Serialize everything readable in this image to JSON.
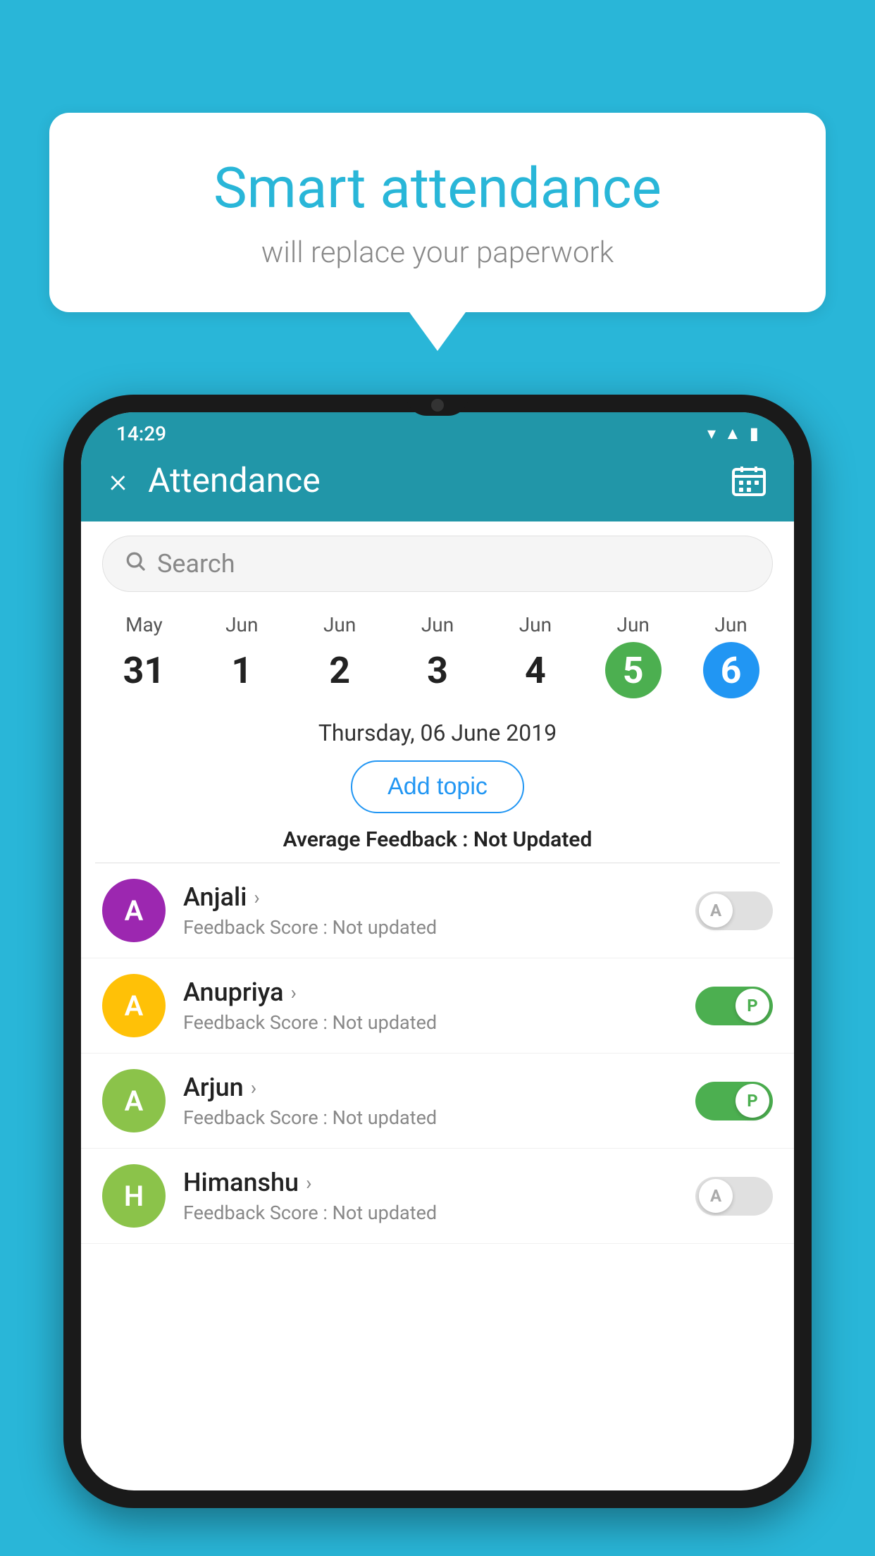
{
  "background_color": "#29B6D8",
  "speech_bubble": {
    "title": "Smart attendance",
    "subtitle": "will replace your paperwork"
  },
  "phone": {
    "status_bar": {
      "time": "14:29",
      "icons": [
        "wifi",
        "signal",
        "battery"
      ]
    },
    "header": {
      "title": "Attendance",
      "close_label": "×",
      "calendar_icon": "📅"
    },
    "search": {
      "placeholder": "Search"
    },
    "dates": [
      {
        "month": "May",
        "day": "31",
        "state": "normal"
      },
      {
        "month": "Jun",
        "day": "1",
        "state": "normal"
      },
      {
        "month": "Jun",
        "day": "2",
        "state": "normal"
      },
      {
        "month": "Jun",
        "day": "3",
        "state": "normal"
      },
      {
        "month": "Jun",
        "day": "4",
        "state": "normal"
      },
      {
        "month": "Jun",
        "day": "5",
        "state": "today"
      },
      {
        "month": "Jun",
        "day": "6",
        "state": "selected"
      }
    ],
    "selected_date": "Thursday, 06 June 2019",
    "add_topic_label": "Add topic",
    "avg_feedback": {
      "label": "Average Feedback : ",
      "value": "Not Updated"
    },
    "students": [
      {
        "name": "Anjali",
        "avatar_letter": "A",
        "avatar_color": "#9C27B0",
        "feedback": "Feedback Score : Not updated",
        "toggle_state": "off",
        "toggle_letter": "A"
      },
      {
        "name": "Anupriya",
        "avatar_letter": "A",
        "avatar_color": "#FFC107",
        "feedback": "Feedback Score : Not updated",
        "toggle_state": "on",
        "toggle_letter": "P"
      },
      {
        "name": "Arjun",
        "avatar_letter": "A",
        "avatar_color": "#8BC34A",
        "feedback": "Feedback Score : Not updated",
        "toggle_state": "on",
        "toggle_letter": "P"
      },
      {
        "name": "Himanshu",
        "avatar_letter": "H",
        "avatar_color": "#8BC34A",
        "feedback": "Feedback Score : Not updated",
        "toggle_state": "off",
        "toggle_letter": "A"
      }
    ]
  }
}
